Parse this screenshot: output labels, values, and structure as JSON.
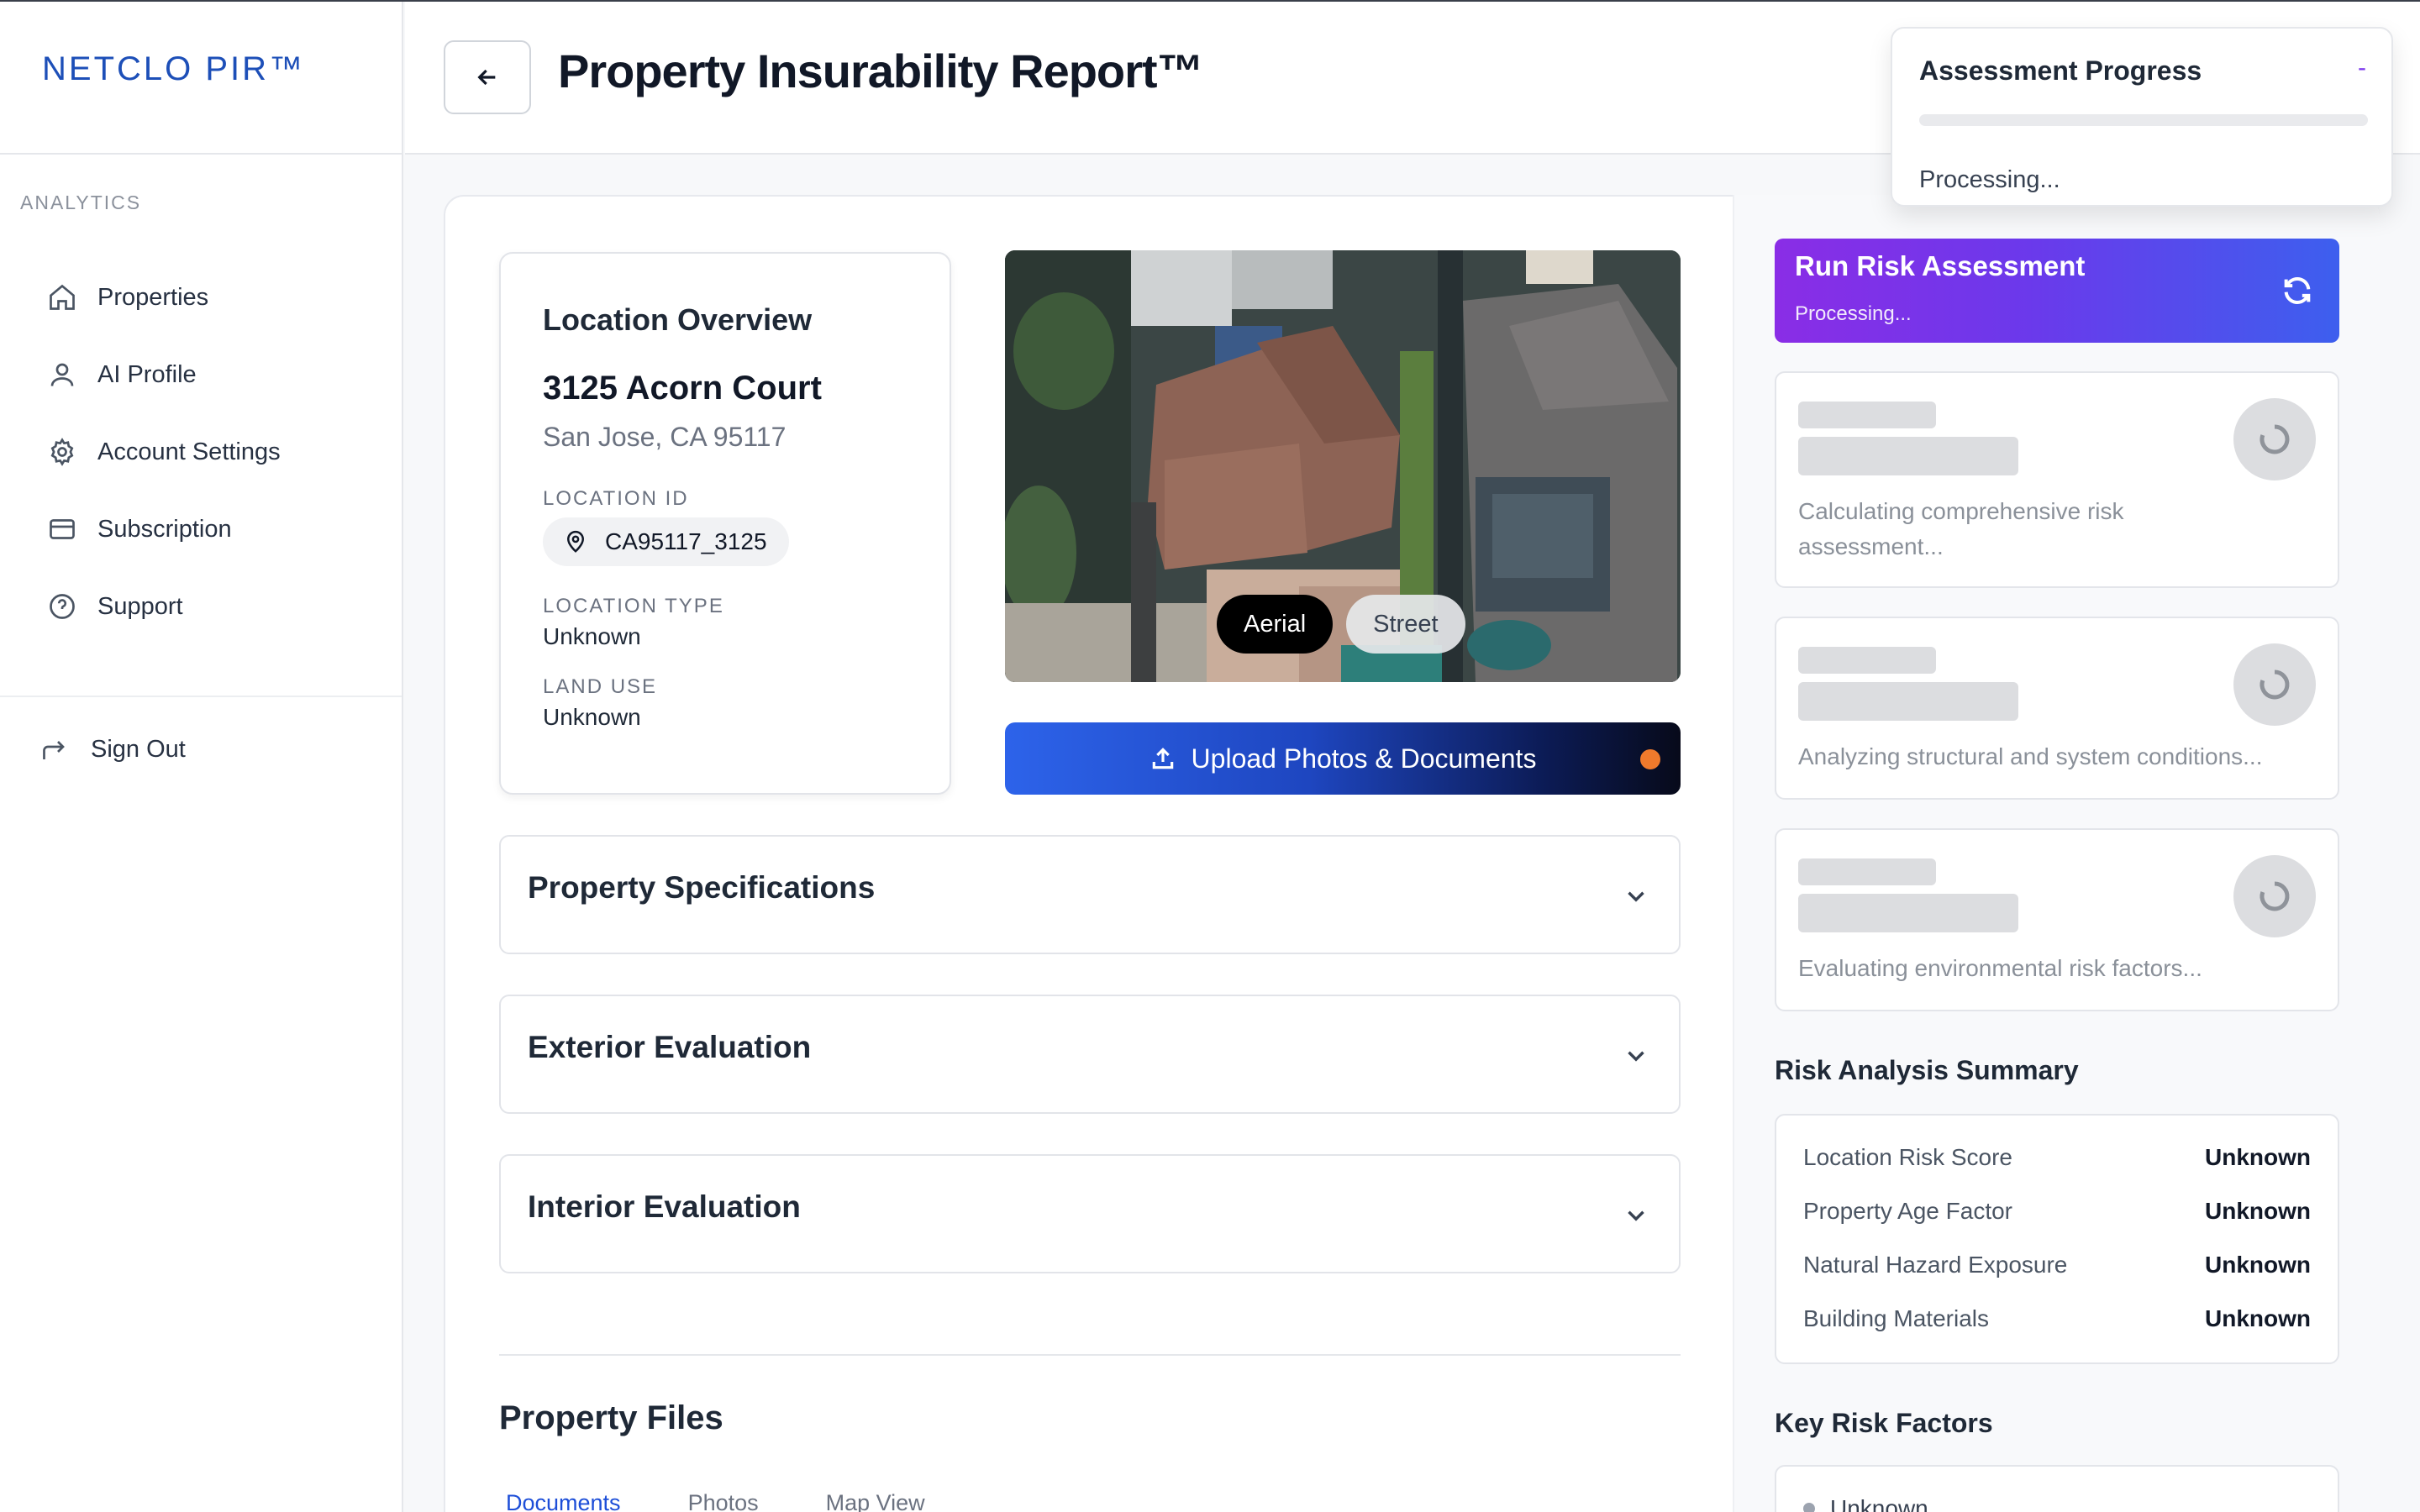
{
  "brand": {
    "name": "NETCLO PIR™"
  },
  "sidebar": {
    "section_label": "ANALYTICS",
    "items": [
      {
        "label": "Properties",
        "icon": "home-icon"
      },
      {
        "label": "AI Profile",
        "icon": "user-icon"
      },
      {
        "label": "Account Settings",
        "icon": "gear-icon"
      },
      {
        "label": "Subscription",
        "icon": "credit-card-icon"
      },
      {
        "label": "Support",
        "icon": "help-circle-icon"
      }
    ],
    "signout_label": "Sign Out"
  },
  "header": {
    "title": "Property Insurability Report™"
  },
  "location": {
    "title": "Location Overview",
    "address": "3125 Acorn Court",
    "city": "San Jose, CA 95117",
    "id_label": "LOCATION ID",
    "id_value": "CA95117_3125",
    "type_label": "LOCATION TYPE",
    "type_value": "Unknown",
    "land_label": "LAND USE",
    "land_value": "Unknown"
  },
  "view_toggle": {
    "aerial": "Aerial",
    "street": "Street",
    "selected": "Aerial"
  },
  "upload": {
    "label": "Upload Photos & Documents",
    "dot_color": "#f07a2c"
  },
  "accordions": [
    {
      "title": "Property Specifications"
    },
    {
      "title": "Exterior Evaluation"
    },
    {
      "title": "Interior Evaluation"
    }
  ],
  "files": {
    "title": "Property Files",
    "tabs": [
      "Documents",
      "Photos",
      "Map View"
    ],
    "active_tab": "Documents"
  },
  "run_assessment": {
    "title": "Run Risk Assessment",
    "status": "Processing..."
  },
  "loading_cards": [
    {
      "text": "Calculating comprehensive risk assessment..."
    },
    {
      "text": "Analyzing structural and system conditions..."
    },
    {
      "text": "Evaluating environmental risk factors..."
    }
  ],
  "summary": {
    "title": "Risk Analysis Summary",
    "rows": [
      {
        "label": "Location Risk Score",
        "value": "Unknown"
      },
      {
        "label": "Property Age Factor",
        "value": "Unknown"
      },
      {
        "label": "Natural Hazard Exposure",
        "value": "Unknown"
      },
      {
        "label": "Building Materials",
        "value": "Unknown"
      }
    ]
  },
  "key_factors": {
    "title": "Key Risk Factors",
    "items": [
      "Unknown"
    ]
  },
  "progress": {
    "title": "Assessment Progress",
    "indicator": "-",
    "status": "Processing...",
    "percent": 0
  },
  "colors": {
    "brand": "#1d4fb8",
    "accent_purple": "#7c3aed",
    "accent_blue": "#2d63ea"
  }
}
